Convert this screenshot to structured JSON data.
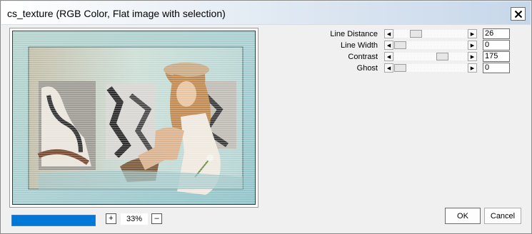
{
  "window": {
    "title": "cs_texture (RGB Color, Flat image with selection)",
    "close_glyph": "✕"
  },
  "parameters": [
    {
      "label": "Line Distance",
      "value": "26",
      "slider_fraction": 0.26
    },
    {
      "label": "Line Width",
      "value": "0",
      "slider_fraction": 0.0
    },
    {
      "label": "Contrast",
      "value": "175",
      "slider_fraction": 0.69
    },
    {
      "label": "Ghost",
      "value": "0",
      "slider_fraction": 0.0
    }
  ],
  "scroll_arrows": {
    "left": "◂",
    "right": "▸"
  },
  "zoom": {
    "plus": "+",
    "minus": "–",
    "value": "33%"
  },
  "progress_fraction": 1.0,
  "buttons": {
    "ok": "OK",
    "cancel": "Cancel"
  },
  "colors": {
    "progress": "#0078d7",
    "title_gradient_end": "#c6d7ea"
  }
}
